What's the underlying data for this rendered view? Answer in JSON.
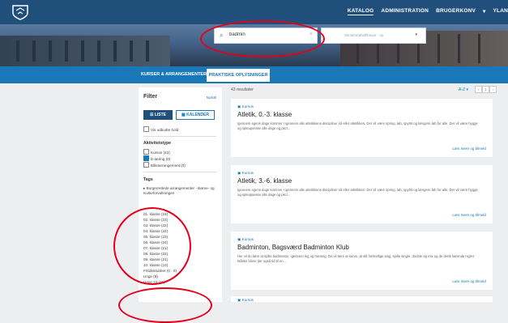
{
  "nav": {
    "items": [
      "KATALOG",
      "ADMINISTRATION",
      "BRUGERKONV",
      "▾",
      "YLAN"
    ]
  },
  "search": {
    "value": "badmin",
    "clear": "×"
  },
  "dropdown": {
    "value": "Skoleforløbsfilhaver - ny",
    "chevron": "▾"
  },
  "tabs": {
    "courses": "KURSER & ARRANGEMENTER",
    "practical": "PRAKTISKE OPLYSNINGER"
  },
  "filter": {
    "title": "Filter",
    "reset": "Nulstil",
    "view_list": "LISTE",
    "view_calendar": "KALENDER",
    "only_available": "Vis udbudte hold",
    "activity_heading": "Aktivitetstype",
    "activity_types": [
      "Kursus (43)",
      "E-læring (0)",
      "Billetarrangement (0)"
    ],
    "tags_heading": "Tags",
    "tags_parent": "Borgerrettede arrangementer - Børne- og Kulturforvaltningen",
    "classes": [
      "01. klasse (19)",
      "02. klasse (23)",
      "03. klasse (22)",
      "04. klasse (22)",
      "05. klasse (23)",
      "06. klasse (24)",
      "07. klasse (21)",
      "08. klasse (22)",
      "09. klasse (21)",
      "10. klasse (10)",
      "Fritidsklubber (0 - 8)",
      "Unge (5)",
      "Unge 24 (11)"
    ]
  },
  "results": {
    "count": "43 resultater",
    "sort": "A-Z ▾",
    "pages": [
      "‹",
      "1",
      "›"
    ],
    "cards": [
      {
        "type": "Kursus",
        "title": "Atletik, 0.-3. klasse",
        "desc": "Igennem egens dage kommer I igennem alle atletikkens discipliner så eller atletikken. Der vil være spring, løb, spytrit og længere løb for alle. Der vil være hygge og spleapsesse alle dage og pkcl...",
        "more": "Læs mere og tilmeld"
      },
      {
        "type": "Kursus",
        "title": "Atletik, 3.-6. klasse",
        "desc": "Igennem egens dage kommer I igennem alle atletikkens discipliner så eller atletikken. Der vil være spring, løb, spytrit og længere løb for alle. Der vil være hygge og spleapsesse alle dage og pkcl...",
        "more": "Læs mere og tilmeld"
      },
      {
        "type": "Kursus",
        "title": "Badminton, Bagsværd Badminton Klub",
        "desc": "Her vil du lære at spille badminton, igennem leg og træning. Du vil lære at serve, at slå forskellige slag, spille single, double og mix og de dertil hørende regler. Måske bliver der også tid til en...",
        "more": "Læs mere og tilmeld"
      },
      {
        "type": "Kursus",
        "title": "",
        "desc": "",
        "more": ""
      }
    ]
  },
  "colors": {
    "topbar": "#1f4f7a",
    "accent": "#1a77b8",
    "highlight": "#e3001b"
  },
  "icons": [
    "crest-logo",
    "search-icon",
    "chevron-down-icon",
    "calendar-icon",
    "list-icon"
  ]
}
